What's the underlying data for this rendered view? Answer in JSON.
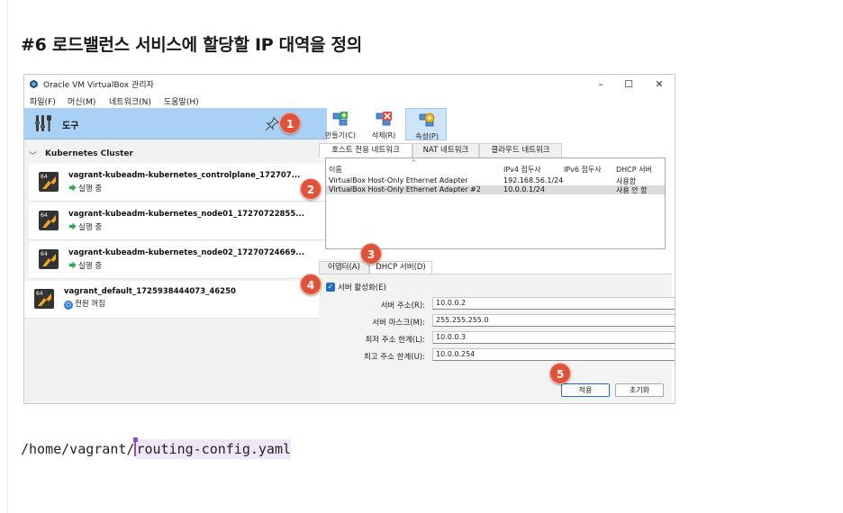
{
  "page": {
    "title": "#6 로드밸런스 서비스에 할당할 IP 대역을 정의",
    "code_path": "/home/vagrant/",
    "code_file": "routing-config.yaml"
  },
  "window": {
    "title": "Oracle VM VirtualBox 관리자",
    "controls": {
      "minimize": "–",
      "maximize": "☐",
      "close": "✕"
    },
    "menu": [
      "파일(F)",
      "머신(M)",
      "네트워크(N)",
      "도움말(H)"
    ]
  },
  "sidebar": {
    "tools_label": "도구",
    "group_label": "Kubernetes Cluster",
    "vms": [
      {
        "name": "vagrant-kubeadm-kubernetes_controlplane_172707...",
        "status": "실행 중",
        "state": "running"
      },
      {
        "name": "vagrant-kubeadm-kubernetes_node01_17270722855...",
        "status": "실행 중",
        "state": "running"
      },
      {
        "name": "vagrant-kubeadm-kubernetes_node02_17270724669...",
        "status": "실행 중",
        "state": "running"
      }
    ],
    "standalone_vm": {
      "name": "vagrant_default_1725938444073_46250",
      "status": "전원 꺼짐",
      "state": "off"
    }
  },
  "toolbar": {
    "create": "만들기(C)",
    "delete": "삭제(R)",
    "properties": "속성(P)"
  },
  "tabs": [
    "호스트 전용 네트워크",
    "NAT 네트워크",
    "클라우드 네트워크"
  ],
  "network_table": {
    "columns": [
      "이름",
      "IPv4 접두사",
      "IPv6 접두사",
      "DHCP 서버"
    ],
    "rows": [
      {
        "name": "VirtualBox Host-Only Ethernet Adapter",
        "ipv4": "192.168.56.1/24",
        "ipv6": "",
        "dhcp": "사용함",
        "selected": false
      },
      {
        "name": "VirtualBox Host-Only Ethernet Adapter #2",
        "ipv4": "10.0.0.1/24",
        "ipv6": "",
        "dhcp": "사용 안 함",
        "selected": true
      }
    ]
  },
  "sub_tabs": [
    "어댑터(A)",
    "DHCP 서버(D)"
  ],
  "dhcp": {
    "enable_label": "서버 활성화(E)",
    "enabled": true,
    "fields": [
      {
        "label": "서버 주소(R):",
        "value": "10.0.0.2"
      },
      {
        "label": "서버 마스크(M):",
        "value": "255.255.255.0"
      },
      {
        "label": "최저 주소 한계(L):",
        "value": "10.0.0.3"
      },
      {
        "label": "최고 주소 한계(U):",
        "value": "10.0.0.254"
      }
    ],
    "apply_label": "적용",
    "reset_label": "초기화"
  },
  "badges": [
    "1",
    "2",
    "3",
    "4",
    "5"
  ],
  "colors": {
    "badge": "#e0533a",
    "selection": "#a9d1f5",
    "code_highlight": "#efe6f7",
    "caret": "#8a4cd1"
  }
}
